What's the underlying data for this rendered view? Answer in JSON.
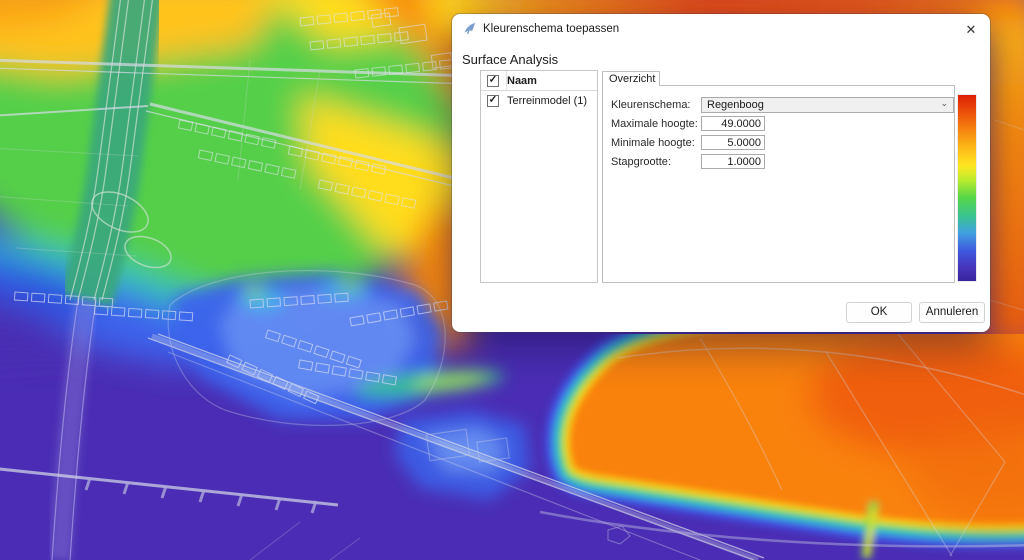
{
  "window": {
    "title": "Kleurenschema toepassen"
  },
  "icons": {
    "close": "✕",
    "chevron_down": "⌄",
    "check": "✓"
  },
  "dialog": {
    "section_title": "Surface Analysis",
    "list": {
      "header": "Naam",
      "items": [
        {
          "label": "Terreinmodel (1)",
          "checked": true
        }
      ]
    },
    "tabs": [
      {
        "label": "Overzicht",
        "active": true
      }
    ],
    "fields": {
      "kleurenschema": {
        "label": "Kleurenschema:",
        "value": "Regenboog"
      },
      "max_hoogte": {
        "label": "Maximale hoogte:",
        "value": "49.0000"
      },
      "min_hoogte": {
        "label": "Minimale hoogte:",
        "value": "5.0000"
      },
      "stapgrootte": {
        "label": "Stapgrootte:",
        "value": "1.0000"
      }
    },
    "buttons": {
      "ok": "OK",
      "cancel": "Annuleren"
    },
    "colorbar_stops": [
      "#dd1f05",
      "#f26a0c",
      "#fbb216",
      "#ffe621",
      "#b8ec2e",
      "#57d647",
      "#3ac48f",
      "#41a2e0",
      "#3e57dd",
      "#4634bb",
      "#37249e"
    ]
  },
  "map_colors": {
    "purple": "#4a2db4",
    "blue": "#3c63ec",
    "green": "#55cf49",
    "teal_highway": "#3aa87c",
    "yellow": "#ffdd1e",
    "orange": "#f9880f",
    "red": "#e63c0a",
    "linework": "#d7dbe8"
  }
}
